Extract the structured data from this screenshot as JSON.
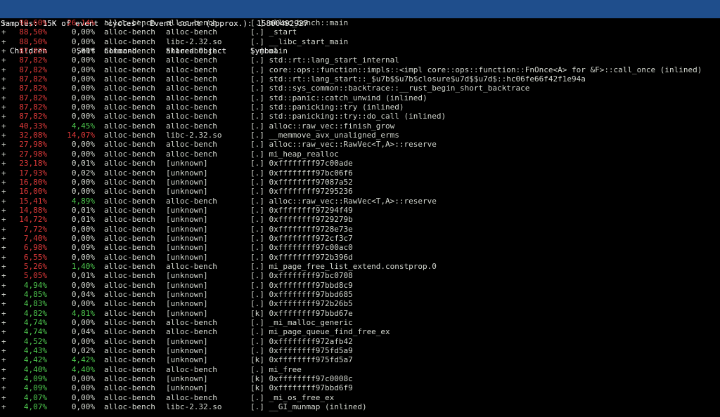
{
  "header": {
    "summary": "Samples: 15K of event 'cycles', Event count (approx.): 15800492927",
    "col_children": "Children",
    "col_self": "Self",
    "col_command": "Command",
    "col_shared_object": "Shared Object",
    "col_symbol": "Symbol"
  },
  "colors": {
    "header_bg": "#1f4e8c",
    "high": "#e23a3a",
    "low": "#4ec94e",
    "default": "#d3d7cf"
  },
  "rows": [
    {
      "children": "90,60%",
      "self": "26,14%",
      "command": "alloc-bench",
      "object": "alloc-bench",
      "symbol": "[.] alloc_bench::main",
      "cc": "red",
      "sc": "red"
    },
    {
      "children": "88,50%",
      "self": "0,00%",
      "command": "alloc-bench",
      "object": "alloc-bench",
      "symbol": "[.] _start",
      "cc": "red",
      "sc": "plain"
    },
    {
      "children": "88,50%",
      "self": "0,00%",
      "command": "alloc-bench",
      "object": "libc-2.32.so",
      "symbol": "[.] __libc_start_main",
      "cc": "red",
      "sc": "plain"
    },
    {
      "children": "87,82%",
      "self": "0,00%",
      "command": "alloc-bench",
      "object": "alloc-bench",
      "symbol": "[.] main",
      "cc": "red",
      "sc": "plain"
    },
    {
      "children": "87,82%",
      "self": "0,00%",
      "command": "alloc-bench",
      "object": "alloc-bench",
      "symbol": "[.] std::rt::lang_start_internal",
      "cc": "red",
      "sc": "plain"
    },
    {
      "children": "87,82%",
      "self": "0,00%",
      "command": "alloc-bench",
      "object": "alloc-bench",
      "symbol": "[.] core::ops::function::impls::<impl core::ops::function::FnOnce<A> for &F>::call_once (inlined)",
      "cc": "red",
      "sc": "plain"
    },
    {
      "children": "87,82%",
      "self": "0,00%",
      "command": "alloc-bench",
      "object": "alloc-bench",
      "symbol": "[.] std::rt::lang_start::_$u7b$$u7b$closure$u7d$$u7d$::hc06fe66f42f1e94a",
      "cc": "red",
      "sc": "plain"
    },
    {
      "children": "87,82%",
      "self": "0,00%",
      "command": "alloc-bench",
      "object": "alloc-bench",
      "symbol": "[.] std::sys_common::backtrace::__rust_begin_short_backtrace",
      "cc": "red",
      "sc": "plain"
    },
    {
      "children": "87,82%",
      "self": "0,00%",
      "command": "alloc-bench",
      "object": "alloc-bench",
      "symbol": "[.] std::panic::catch_unwind (inlined)",
      "cc": "red",
      "sc": "plain"
    },
    {
      "children": "87,82%",
      "self": "0,00%",
      "command": "alloc-bench",
      "object": "alloc-bench",
      "symbol": "[.] std::panicking::try (inlined)",
      "cc": "red",
      "sc": "plain"
    },
    {
      "children": "87,82%",
      "self": "0,00%",
      "command": "alloc-bench",
      "object": "alloc-bench",
      "symbol": "[.] std::panicking::try::do_call (inlined)",
      "cc": "red",
      "sc": "plain"
    },
    {
      "children": "40,33%",
      "self": "4,45%",
      "command": "alloc-bench",
      "object": "alloc-bench",
      "symbol": "[.] alloc::raw_vec::finish_grow",
      "cc": "red",
      "sc": "green"
    },
    {
      "children": "32,08%",
      "self": "14,07%",
      "command": "alloc-bench",
      "object": "libc-2.32.so",
      "symbol": "[.] __memmove_avx_unaligned_erms",
      "cc": "red",
      "sc": "red"
    },
    {
      "children": "27,98%",
      "self": "0,00%",
      "command": "alloc-bench",
      "object": "alloc-bench",
      "symbol": "[.] alloc::raw_vec::RawVec<T,A>::reserve",
      "cc": "red",
      "sc": "plain"
    },
    {
      "children": "27,98%",
      "self": "0,00%",
      "command": "alloc-bench",
      "object": "alloc-bench",
      "symbol": "[.] mi_heap_realloc",
      "cc": "red",
      "sc": "plain"
    },
    {
      "children": "23,18%",
      "self": "0,01%",
      "command": "alloc-bench",
      "object": "[unknown]",
      "symbol": "[.] 0xffffffff97c00ade",
      "cc": "red",
      "sc": "plain"
    },
    {
      "children": "17,93%",
      "self": "0,02%",
      "command": "alloc-bench",
      "object": "[unknown]",
      "symbol": "[.] 0xffffffff97bc06f6",
      "cc": "red",
      "sc": "plain"
    },
    {
      "children": "16,80%",
      "self": "0,00%",
      "command": "alloc-bench",
      "object": "[unknown]",
      "symbol": "[.] 0xffffffff97087a52",
      "cc": "red",
      "sc": "plain"
    },
    {
      "children": "16,00%",
      "self": "0,00%",
      "command": "alloc-bench",
      "object": "[unknown]",
      "symbol": "[.] 0xffffffff97295236",
      "cc": "red",
      "sc": "plain"
    },
    {
      "children": "15,41%",
      "self": "4,89%",
      "command": "alloc-bench",
      "object": "alloc-bench",
      "symbol": "[.] alloc::raw_vec::RawVec<T,A>::reserve",
      "cc": "red",
      "sc": "green"
    },
    {
      "children": "14,88%",
      "self": "0,01%",
      "command": "alloc-bench",
      "object": "[unknown]",
      "symbol": "[.] 0xffffffff97294f49",
      "cc": "red",
      "sc": "plain"
    },
    {
      "children": "14,72%",
      "self": "0,01%",
      "command": "alloc-bench",
      "object": "[unknown]",
      "symbol": "[.] 0xffffffff9729279b",
      "cc": "red",
      "sc": "plain"
    },
    {
      "children": "7,72%",
      "self": "0,00%",
      "command": "alloc-bench",
      "object": "[unknown]",
      "symbol": "[.] 0xffffffff9728e73e",
      "cc": "red",
      "sc": "plain"
    },
    {
      "children": "7,40%",
      "self": "0,00%",
      "command": "alloc-bench",
      "object": "[unknown]",
      "symbol": "[.] 0xffffffff972cf3c7",
      "cc": "red",
      "sc": "plain"
    },
    {
      "children": "6,98%",
      "self": "0,09%",
      "command": "alloc-bench",
      "object": "[unknown]",
      "symbol": "[.] 0xffffffff97c00ac0",
      "cc": "red",
      "sc": "plain"
    },
    {
      "children": "6,55%",
      "self": "0,00%",
      "command": "alloc-bench",
      "object": "[unknown]",
      "symbol": "[.] 0xffffffff972b396d",
      "cc": "red",
      "sc": "plain"
    },
    {
      "children": "5,26%",
      "self": "1,40%",
      "command": "alloc-bench",
      "object": "alloc-bench",
      "symbol": "[.] mi_page_free_list_extend.constprop.0",
      "cc": "red",
      "sc": "green"
    },
    {
      "children": "5,05%",
      "self": "0,01%",
      "command": "alloc-bench",
      "object": "[unknown]",
      "symbol": "[.] 0xffffffff97bc0708",
      "cc": "red",
      "sc": "plain"
    },
    {
      "children": "4,94%",
      "self": "0,00%",
      "command": "alloc-bench",
      "object": "[unknown]",
      "symbol": "[.] 0xffffffff97bbd8c9",
      "cc": "green",
      "sc": "plain"
    },
    {
      "children": "4,85%",
      "self": "0,04%",
      "command": "alloc-bench",
      "object": "[unknown]",
      "symbol": "[.] 0xffffffff97bbd685",
      "cc": "green",
      "sc": "plain"
    },
    {
      "children": "4,83%",
      "self": "0,00%",
      "command": "alloc-bench",
      "object": "[unknown]",
      "symbol": "[.] 0xffffffff972b26b5",
      "cc": "green",
      "sc": "plain"
    },
    {
      "children": "4,82%",
      "self": "4,81%",
      "command": "alloc-bench",
      "object": "[unknown]",
      "symbol": "[k] 0xffffffff97bbd67e",
      "cc": "green",
      "sc": "green"
    },
    {
      "children": "4,74%",
      "self": "0,00%",
      "command": "alloc-bench",
      "object": "alloc-bench",
      "symbol": "[.] _mi_malloc_generic",
      "cc": "green",
      "sc": "plain"
    },
    {
      "children": "4,74%",
      "self": "0,04%",
      "command": "alloc-bench",
      "object": "alloc-bench",
      "symbol": "[.] mi_page_queue_find_free_ex",
      "cc": "green",
      "sc": "plain"
    },
    {
      "children": "4,52%",
      "self": "0,00%",
      "command": "alloc-bench",
      "object": "[unknown]",
      "symbol": "[.] 0xffffffff972afb42",
      "cc": "green",
      "sc": "plain"
    },
    {
      "children": "4,43%",
      "self": "0,02%",
      "command": "alloc-bench",
      "object": "[unknown]",
      "symbol": "[.] 0xffffffff975fd5a9",
      "cc": "green",
      "sc": "plain"
    },
    {
      "children": "4,42%",
      "self": "4,42%",
      "command": "alloc-bench",
      "object": "[unknown]",
      "symbol": "[k] 0xffffffff975fd5a7",
      "cc": "green",
      "sc": "green"
    },
    {
      "children": "4,40%",
      "self": "4,40%",
      "command": "alloc-bench",
      "object": "alloc-bench",
      "symbol": "[.] mi_free",
      "cc": "green",
      "sc": "green"
    },
    {
      "children": "4,09%",
      "self": "0,00%",
      "command": "alloc-bench",
      "object": "[unknown]",
      "symbol": "[k] 0xffffffff97c0008c",
      "cc": "green",
      "sc": "plain"
    },
    {
      "children": "4,09%",
      "self": "0,00%",
      "command": "alloc-bench",
      "object": "[unknown]",
      "symbol": "[k] 0xffffffff97bbd6f9",
      "cc": "green",
      "sc": "plain"
    },
    {
      "children": "4,07%",
      "self": "0,00%",
      "command": "alloc-bench",
      "object": "alloc-bench",
      "symbol": "[.] _mi_os_free_ex",
      "cc": "green",
      "sc": "plain"
    },
    {
      "children": "4,07%",
      "self": "0,00%",
      "command": "alloc-bench",
      "object": "libc-2.32.so",
      "symbol": "[.] __GI_munmap (inlined)",
      "cc": "green",
      "sc": "plain"
    }
  ]
}
